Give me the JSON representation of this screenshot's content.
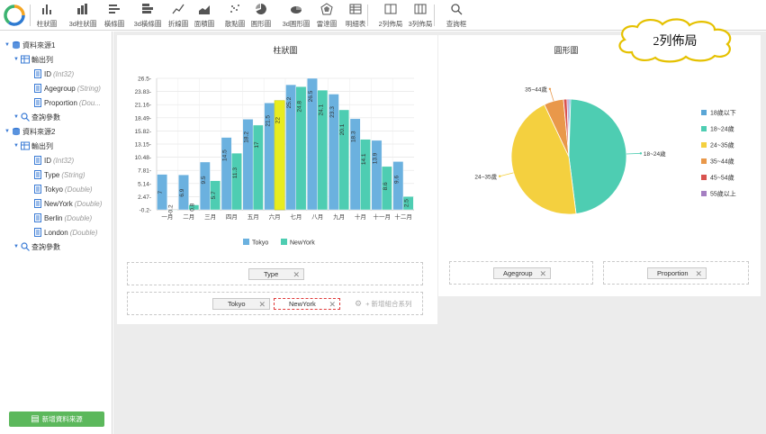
{
  "toolbar": {
    "items": [
      {
        "label": "柱狀圖",
        "icon": "bar-chart-icon"
      },
      {
        "label": "3d柱狀圖",
        "icon": "bar-3d-chart-icon"
      },
      {
        "label": "橫條圖",
        "icon": "horizontal-bar-icon"
      },
      {
        "label": "3d橫條圖",
        "icon": "horizontal-bar-3d-icon"
      },
      {
        "label": "折線圖",
        "icon": "line-chart-icon"
      },
      {
        "label": "面積圖",
        "icon": "area-chart-icon"
      },
      {
        "label": "散點圖",
        "icon": "scatter-chart-icon"
      },
      {
        "label": "圓形圖",
        "icon": "pie-chart-icon"
      },
      {
        "label": "3d圓形圖",
        "icon": "pie-3d-chart-icon"
      },
      {
        "label": "雷達圖",
        "icon": "radar-chart-icon"
      },
      {
        "label": "明細表",
        "icon": "table-icon"
      },
      {
        "label": "2列佈局",
        "icon": "two-column-layout-icon"
      },
      {
        "label": "3列佈局",
        "icon": "three-column-layout-icon"
      },
      {
        "label": "查詢框",
        "icon": "search-icon"
      }
    ]
  },
  "sidebar": {
    "source1": {
      "label": "資料來源1",
      "output": "輸出列",
      "fields": [
        {
          "name": "ID",
          "type": "(Int32)"
        },
        {
          "name": "Agegroup",
          "type": "(String)"
        },
        {
          "name": "Proportion",
          "type": "(Dou..."
        }
      ],
      "query": "查詢參數"
    },
    "source2": {
      "label": "資料來源2",
      "output": "輸出列",
      "fields": [
        {
          "name": "ID",
          "type": "(Int32)"
        },
        {
          "name": "Type",
          "type": "(String)"
        },
        {
          "name": "Tokyo",
          "type": "(Double)"
        },
        {
          "name": "NewYork",
          "type": "(Double)"
        },
        {
          "name": "Berlin",
          "type": "(Double)"
        },
        {
          "name": "London",
          "type": "(Double)"
        }
      ],
      "query": "查詢參數"
    },
    "add_button": "新增資料來源"
  },
  "bar_panel": {
    "category_chip": "Type",
    "series_chips": [
      "Tokyo",
      "NewYork"
    ],
    "add_series": "新增組合系列"
  },
  "pie_panel": {
    "category_chip": "Agegroup",
    "value_chip": "Proportion"
  },
  "callout": {
    "text": "2列佈局"
  },
  "colors": {
    "tokyo": "#6bb1df",
    "newyork": "#4ecdb2",
    "highlight": "#e8ec1f",
    "green_button": "#5cb85c"
  },
  "chart_data": [
    {
      "type": "bar",
      "title": "柱狀圖",
      "categories": [
        "一月",
        "二月",
        "三月",
        "四月",
        "五月",
        "六月",
        "七月",
        "八月",
        "九月",
        "十月",
        "十一月",
        "十二月"
      ],
      "series": [
        {
          "name": "Tokyo",
          "values": [
            7,
            6.9,
            9.5,
            14.5,
            18.2,
            21.5,
            25.2,
            26.5,
            23.3,
            18.3,
            13.9,
            9.6
          ]
        },
        {
          "name": "NewYork",
          "values": [
            -0.2,
            0.8,
            5.7,
            11.3,
            17,
            22,
            24.8,
            24.1,
            20.1,
            14.1,
            8.6,
            2.5
          ]
        }
      ],
      "yticks": [
        "-0.2",
        "2.47",
        "5.14",
        "7.81",
        "10.48",
        "13.15",
        "15.82",
        "18.49",
        "21.16",
        "23.83",
        "26.5"
      ],
      "ylim": [
        -0.2,
        26.5
      ],
      "highlight": {
        "category": "六月",
        "series": "NewYork"
      },
      "legend": "bottom-center"
    },
    {
      "type": "pie",
      "title": "圓形圖",
      "categories": [
        "18歲以下",
        "18~24歲",
        "24~35歲",
        "35~44歲",
        "45~54歲",
        "55歲以上"
      ],
      "values": [
        0.5,
        47.5,
        45,
        5.5,
        1,
        0.5
      ],
      "colors": [
        "#5aa6d6",
        "#4ecdb2",
        "#f4d03f",
        "#e9984a",
        "#d9534f",
        "#a57fc2"
      ],
      "labels": [
        "18~24歲",
        "24~35歲",
        "35~44歲"
      ],
      "legend": "right"
    }
  ]
}
